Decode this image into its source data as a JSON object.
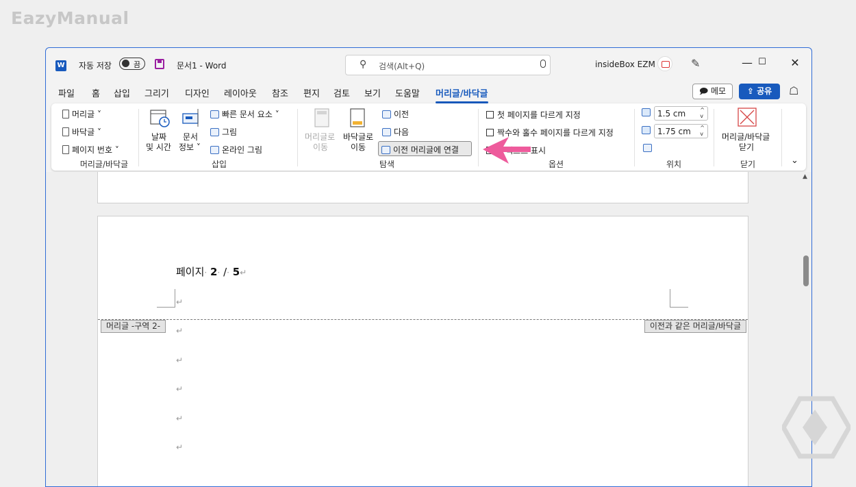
{
  "watermark": "EazyManual",
  "titlebar": {
    "app_logo": "W",
    "autosave_label": "자동 저장",
    "autosave_state": "끔",
    "doc_title": "문서1  -  Word",
    "search_placeholder": "검색(Alt+Q)",
    "user_name": "insideBox EZM"
  },
  "tabs": [
    "파일",
    "홈",
    "삽입",
    "그리기",
    "디자인",
    "레이아웃",
    "참조",
    "편지",
    "검토",
    "보기",
    "도움말",
    "머리글/바닥글"
  ],
  "active_tab": "머리글/바닥글",
  "top_buttons": {
    "memo": "메모",
    "share": "공유"
  },
  "ribbon": {
    "group_header_footer": {
      "label": "머리글/바닥글",
      "header": "머리글",
      "footer": "바닥글",
      "page_number": "페이지 번호"
    },
    "group_insert": {
      "label": "삽입",
      "date_time_1": "날짜",
      "date_time_2": "및 시간",
      "doc_info_1": "문서",
      "doc_info_2": "정보",
      "quick_parts": "빠른 문서 요소",
      "picture": "그림",
      "online_picture": "온라인 그림"
    },
    "group_navigation": {
      "label": "탐색",
      "goto_header_1": "머리글로",
      "goto_header_2": "이동",
      "goto_footer_1": "바닥글로",
      "goto_footer_2": "이동",
      "previous": "이전",
      "next": "다음",
      "link_to_previous": "이전 머리글에 연결"
    },
    "group_options": {
      "label": "옵션",
      "different_first_page": "첫 페이지를 다르게 지정",
      "different_odd_even": "짝수와 홀수 페이지를 다르게 지정",
      "show_document_text": "문서 텍스트 표시",
      "show_document_text_visible": "텍스트 표시"
    },
    "group_position": {
      "label": "위치",
      "header_from_top": "1.5 cm",
      "footer_from_bottom": "1.75 cm"
    },
    "group_close": {
      "label": "닫기",
      "close_1": "머리글/바닥글",
      "close_2": "닫기"
    }
  },
  "document": {
    "page_prefix": "페이지",
    "page_current": "2",
    "page_sep": "/",
    "page_total": "5",
    "header_tag": "머리글 -구역 2-",
    "same_as_previous": "이전과 같은 머리글/바닥글",
    "return_mark": "↵"
  },
  "colors": {
    "accent": "#185abd",
    "arrow": "#ee5b9c"
  }
}
